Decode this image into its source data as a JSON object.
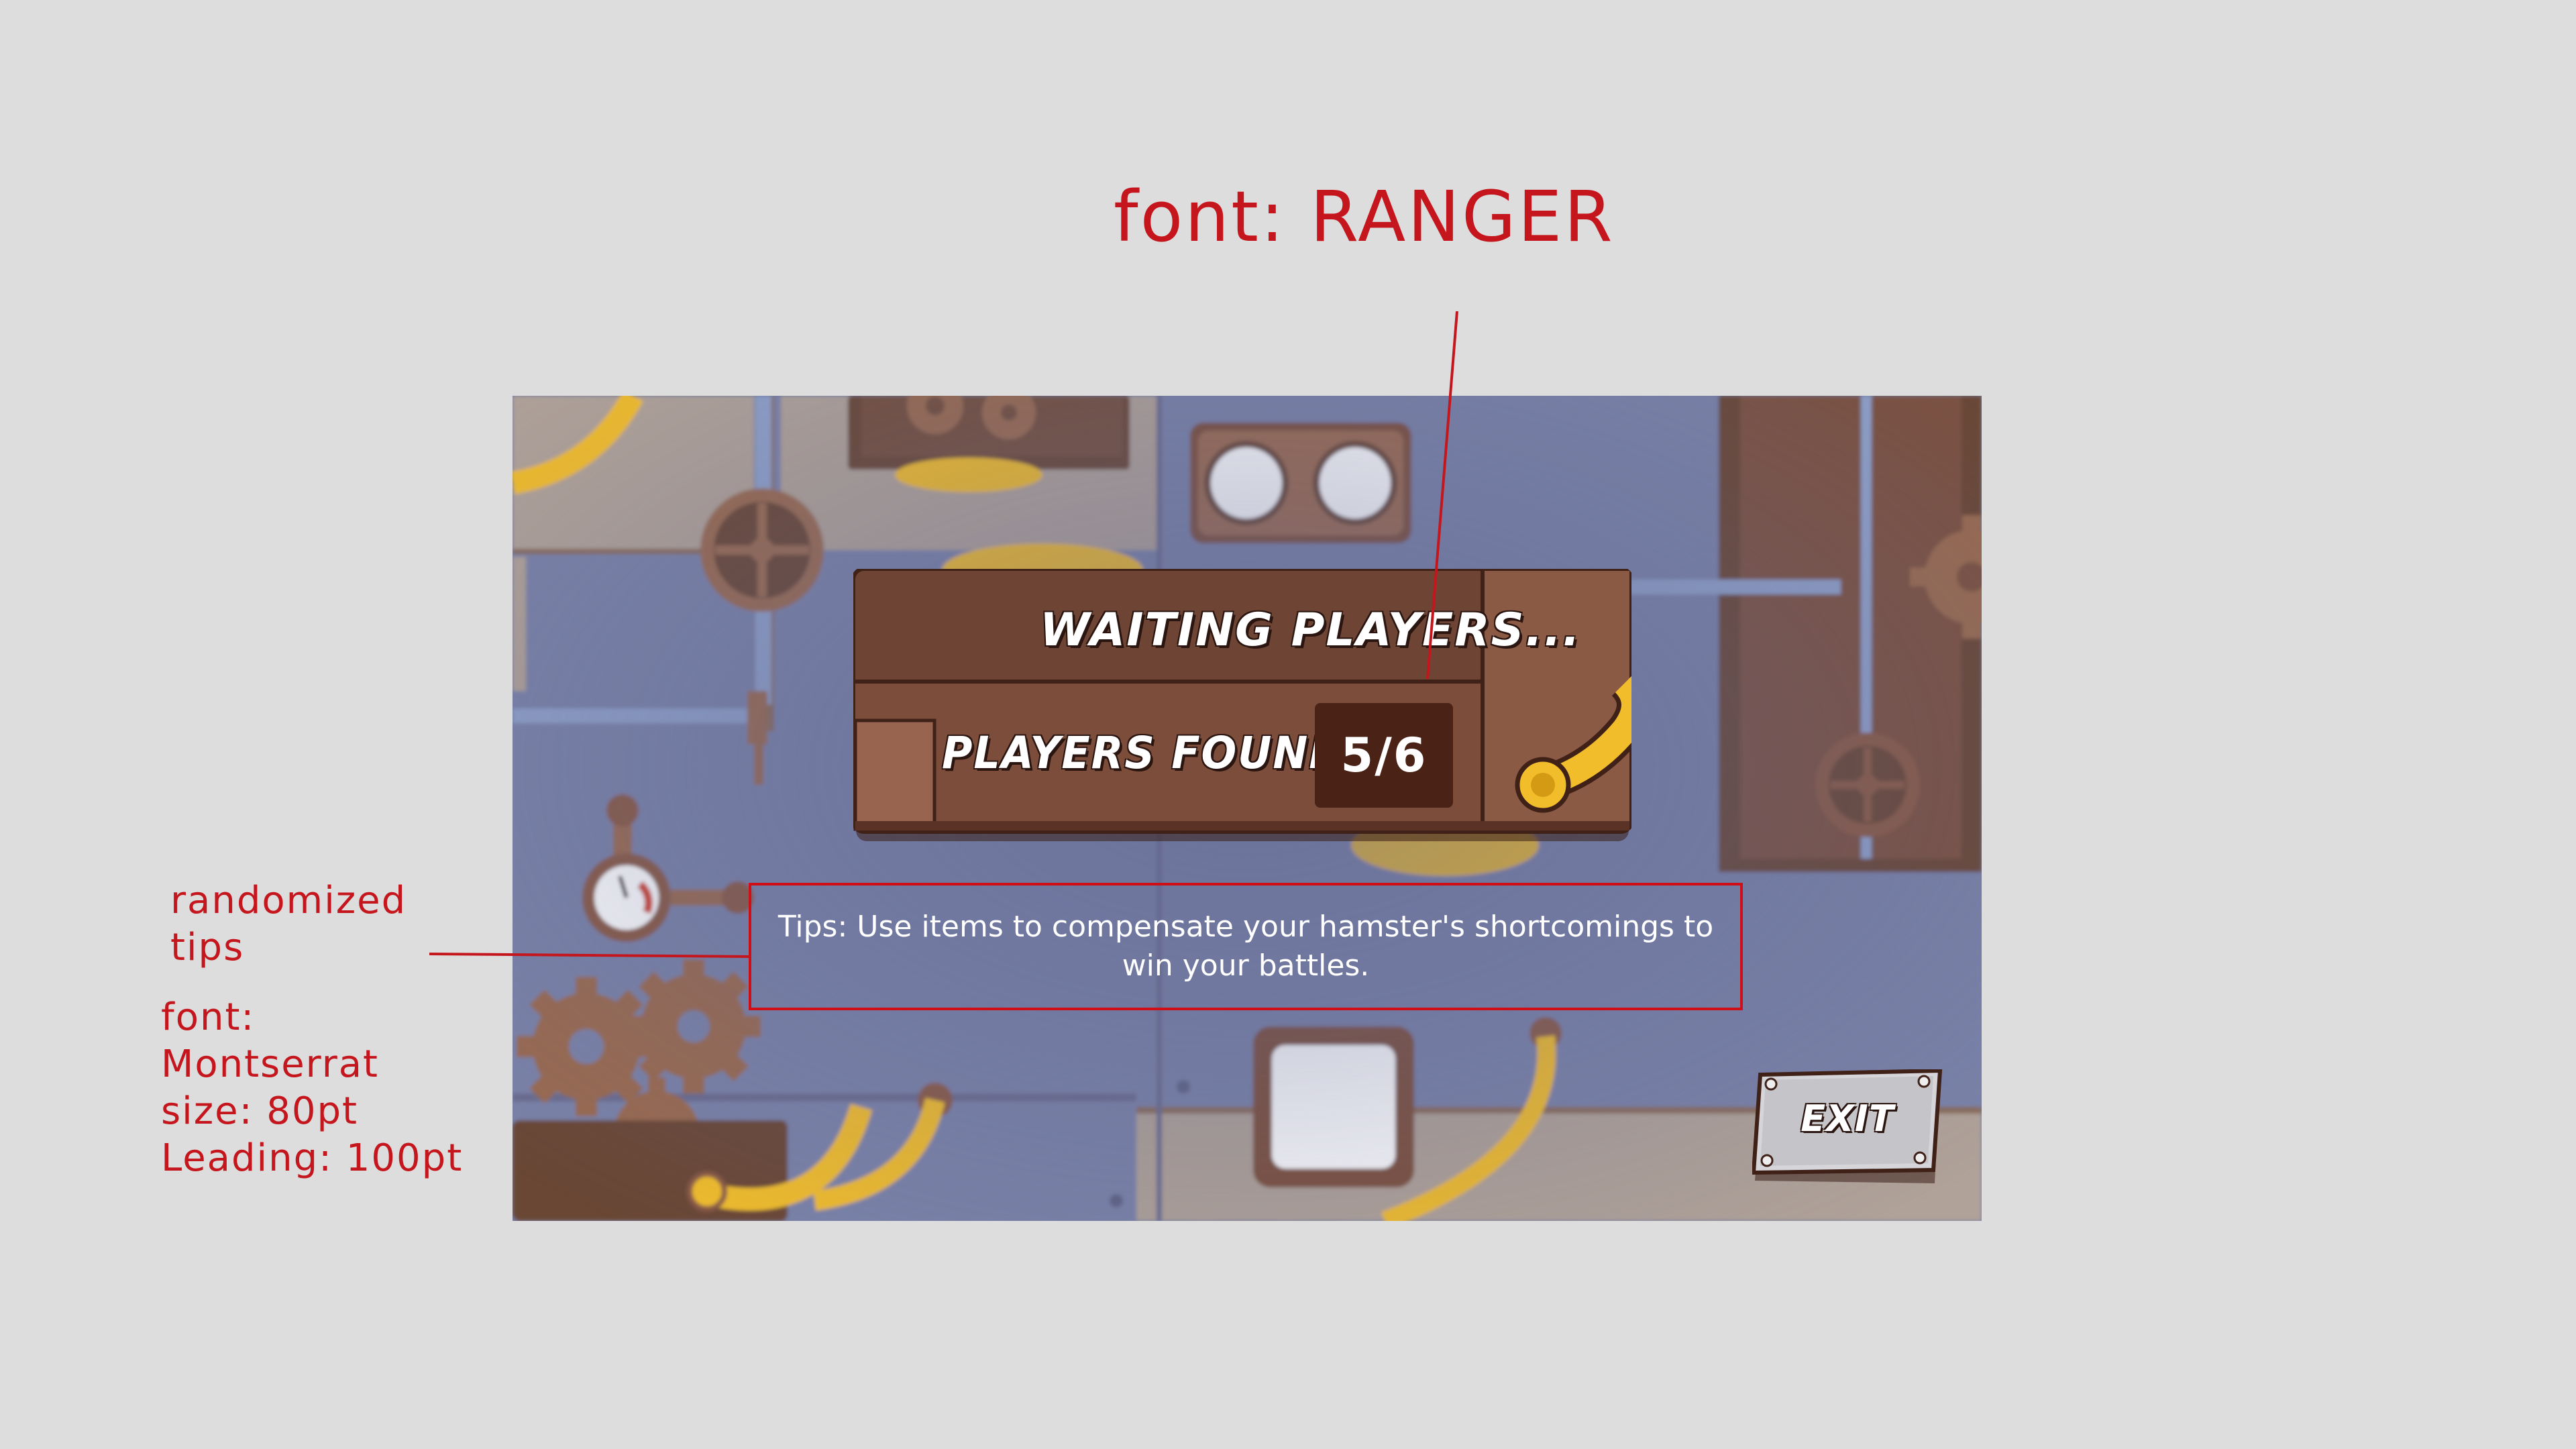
{
  "annotations": {
    "font_title": "font: RANGER",
    "tips_label": "randomized\ntips",
    "tip_font_lines": [
      "font:",
      "Montserrat",
      "size: 80pt",
      "Leading: 100pt"
    ]
  },
  "waiting_panel": {
    "title": "WAITING PLAYERS...",
    "players_found_label": "PLAYERS FOUND:",
    "player_count": "5/6",
    "players_found": 5,
    "players_total": 6
  },
  "tip": {
    "text": "Tips: Use items to compensate your hamster's shortcomings to win your battles."
  },
  "exit_button": {
    "label": "EXIT"
  },
  "colors": {
    "annotation_red": "#c4161c",
    "panel_brown": "#6e4534",
    "count_box": "#4a2216",
    "background_blue": "#7880a6",
    "pipe_yellow": "#f2bd2a"
  }
}
